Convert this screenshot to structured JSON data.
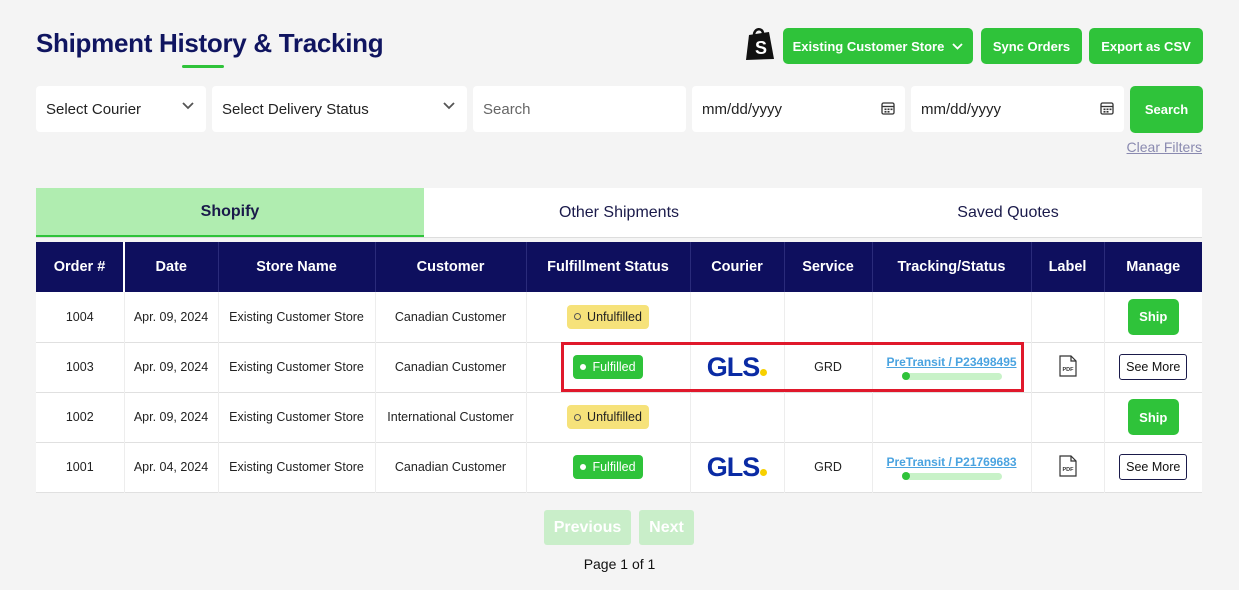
{
  "header": {
    "title": "Shipment History & Tracking",
    "store_select": "Existing Customer Store",
    "sync_label": "Sync Orders",
    "export_label": "Export as CSV",
    "accent": "#2fc33a",
    "brand_navy": "#0e0f5e"
  },
  "filters": {
    "courier": "Select Courier",
    "delivery_status": "Select Delivery Status",
    "search_placeholder": "Search",
    "date_from_placeholder": "mm/dd/yyyy",
    "date_to_placeholder": "mm/dd/yyyy",
    "search_button": "Search",
    "clear_filters": "Clear Filters"
  },
  "tabs": [
    {
      "label": "Shopify",
      "active": true
    },
    {
      "label": "Other Shipments",
      "active": false
    },
    {
      "label": "Saved Quotes",
      "active": false
    }
  ],
  "table": {
    "columns": [
      "Order #",
      "Date",
      "Store Name",
      "Customer",
      "Fulfillment Status",
      "Courier",
      "Service",
      "Tracking/Status",
      "Label",
      "Manage"
    ],
    "rows": [
      {
        "order": "1004",
        "date": "Apr. 09, 2024",
        "store": "Existing Customer Store",
        "customer": "Canadian Customer",
        "status": "Unfulfilled",
        "courier": "",
        "service": "",
        "tracking": "",
        "manage": "Ship"
      },
      {
        "order": "1003",
        "date": "Apr. 09, 2024",
        "store": "Existing Customer Store",
        "customer": "Canadian Customer",
        "status": "Fulfilled",
        "courier": "GLS",
        "service": "GRD",
        "tracking": "PreTransit / P23498495",
        "label": "PDF",
        "manage": "See More"
      },
      {
        "order": "1002",
        "date": "Apr. 09, 2024",
        "store": "Existing Customer Store",
        "customer": "International Customer",
        "status": "Unfulfilled",
        "courier": "",
        "service": "",
        "tracking": "",
        "manage": "Ship"
      },
      {
        "order": "1001",
        "date": "Apr. 04, 2024",
        "store": "Existing Customer Store",
        "customer": "Canadian Customer",
        "status": "Fulfilled",
        "courier": "GLS",
        "service": "GRD",
        "tracking": "PreTransit / P21769683",
        "label": "PDF",
        "manage": "See More"
      }
    ]
  },
  "pagination": {
    "previous": "Previous",
    "next": "Next",
    "page_info": "Page 1 of 1"
  }
}
